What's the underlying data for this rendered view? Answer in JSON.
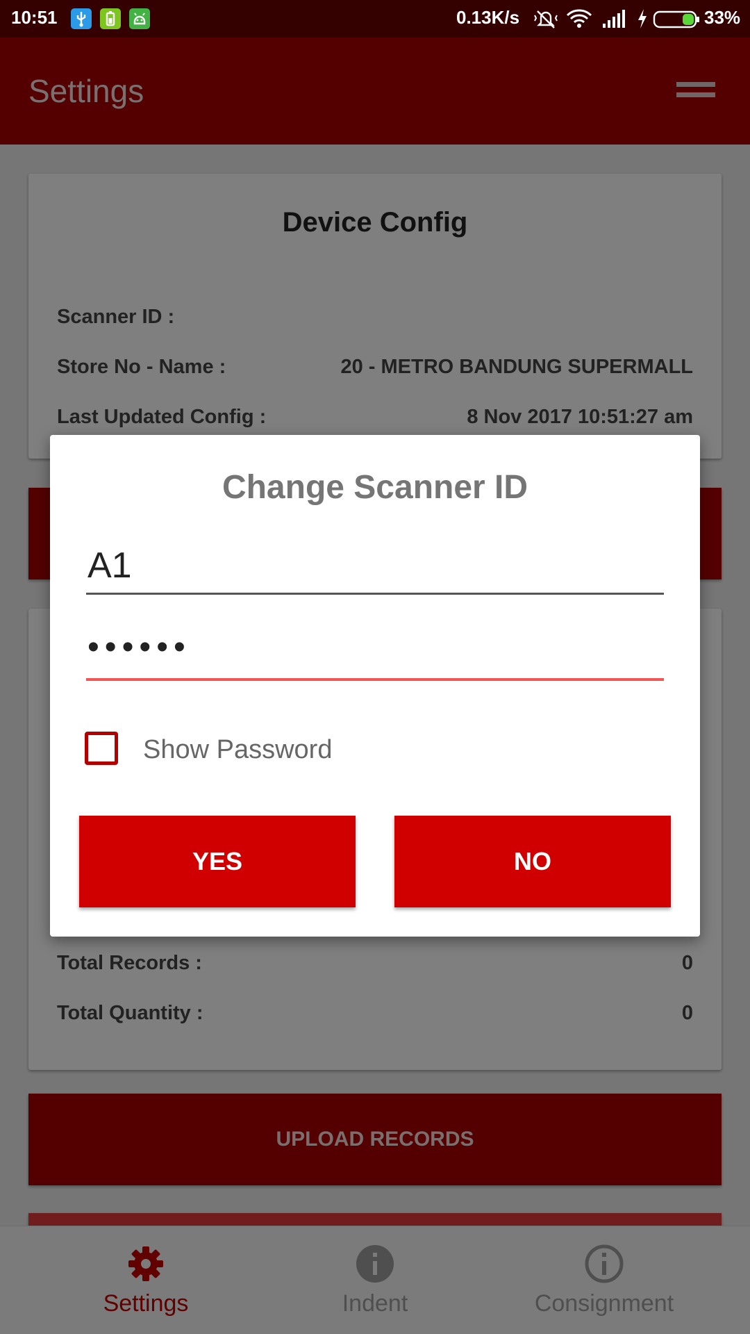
{
  "status_bar": {
    "time": "10:51",
    "net_speed": "0.13K/s",
    "battery": "33%"
  },
  "app_bar": {
    "title": "Settings",
    "menu_icon": "hamburger-menu-icon"
  },
  "device_config": {
    "title": "Device Config",
    "rows": [
      {
        "label": "Scanner ID :",
        "value": ""
      },
      {
        "label": "Store No - Name :",
        "value": "20 - METRO BANDUNG SUPERMALL"
      },
      {
        "label": "Last Updated Config :",
        "value": "8 Nov 2017 10:51:27 am"
      }
    ]
  },
  "records": {
    "rows": [
      {
        "label": "Total Records :",
        "value": "0"
      },
      {
        "label": "Total Quantity :",
        "value": "0"
      }
    ]
  },
  "upload_button": {
    "label": "UPLOAD RECORDS"
  },
  "bottom_nav": {
    "items": [
      {
        "label": "Settings",
        "icon": "gear-icon",
        "active": true
      },
      {
        "label": "Indent",
        "icon": "info-filled-icon",
        "active": false
      },
      {
        "label": "Consignment",
        "icon": "info-outline-icon",
        "active": false
      }
    ]
  },
  "dialog": {
    "title": "Change Scanner ID",
    "scanner_id_value": "A1",
    "password_mask": "••••••",
    "show_password_label": "Show Password",
    "show_password_checked": false,
    "yes_label": "YES",
    "no_label": "NO"
  },
  "colors": {
    "primary": "#a80000",
    "button_red": "#d10000",
    "status_bar": "#340000",
    "focus_line": "#f25555"
  }
}
